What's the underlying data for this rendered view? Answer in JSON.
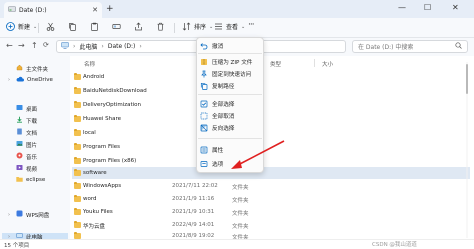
{
  "window": {
    "tab_title": "Date (D:)",
    "new_tab": "+",
    "minimize": "—",
    "maximize": "☐",
    "close": "✕"
  },
  "toolbar": {
    "new_label": "新建",
    "sort_label": "排序",
    "view_label": "查看",
    "more": "···"
  },
  "address": {
    "path": [
      "此电脑",
      "Date (D:)"
    ],
    "search_placeholder": "在 Date (D:) 中搜索"
  },
  "sidebar": {
    "items": [
      {
        "label": "主文件夹",
        "chev": ""
      },
      {
        "label": "OneDrive",
        "chev": "›"
      },
      {
        "label": "桌面",
        "chev": ""
      },
      {
        "label": "下载",
        "chev": ""
      },
      {
        "label": "文档",
        "chev": ""
      },
      {
        "label": "图片",
        "chev": ""
      },
      {
        "label": "音乐",
        "chev": ""
      },
      {
        "label": "视频",
        "chev": ""
      },
      {
        "label": "eclipse",
        "chev": ""
      },
      {
        "label": "WPS网盘",
        "chev": "›"
      },
      {
        "label": "此电脑",
        "chev": "›"
      }
    ],
    "colors": {
      "selected": "#cfe3f7"
    }
  },
  "columns": {
    "name": "名称",
    "type": "类型",
    "size": "大小"
  },
  "files": [
    {
      "name": "Android",
      "date": "",
      "type": ""
    },
    {
      "name": "BaiduNetdiskDownload",
      "date": "",
      "type": ""
    },
    {
      "name": "DeliveryOptimization",
      "date": "",
      "type": ""
    },
    {
      "name": "Huawei Share",
      "date": "",
      "type": ""
    },
    {
      "name": "local",
      "date": "",
      "type": ""
    },
    {
      "name": "Program Files",
      "date": "",
      "type": ""
    },
    {
      "name": "Program Files (x86)",
      "date": "",
      "type": ""
    },
    {
      "name": "software",
      "date": "",
      "type": ""
    },
    {
      "name": "WindowsApps",
      "date": "2021/7/11 22:02",
      "type": "文件夹"
    },
    {
      "name": "word",
      "date": "2021/1/9 11:16",
      "type": "文件夹"
    },
    {
      "name": "Youku Files",
      "date": "2021/1/9 10:31",
      "type": "文件夹"
    },
    {
      "name": "华为云盘",
      "date": "2022/4/9 14:01",
      "type": "文件夹"
    },
    {
      "name": "",
      "date": "2021/8/9 19:02",
      "type": "文件夹"
    }
  ],
  "context_menu": {
    "items": [
      {
        "label": "撤消",
        "icon": "undo-icon"
      },
      {
        "label": "压缩为 ZIP 文件",
        "icon": "zip-icon"
      },
      {
        "label": "固定到快速访问",
        "icon": "pin-icon"
      },
      {
        "label": "复制路径",
        "icon": "copy-path-icon"
      },
      {
        "label": "全部选择",
        "icon": "select-all-icon"
      },
      {
        "label": "全部取消",
        "icon": "select-none-icon"
      },
      {
        "label": "反向选择",
        "icon": "invert-selection-icon"
      },
      {
        "label": "属性",
        "icon": "properties-icon"
      },
      {
        "label": "选项",
        "icon": "options-icon"
      }
    ]
  },
  "status": {
    "count": "15 个项目"
  },
  "watermark": "CSDN @我山道道",
  "colors": {
    "accent": "#0067c0",
    "annotation_arrow": "#e02020",
    "folder": "#f2c14e",
    "selected_row": "#dfe8f3"
  }
}
